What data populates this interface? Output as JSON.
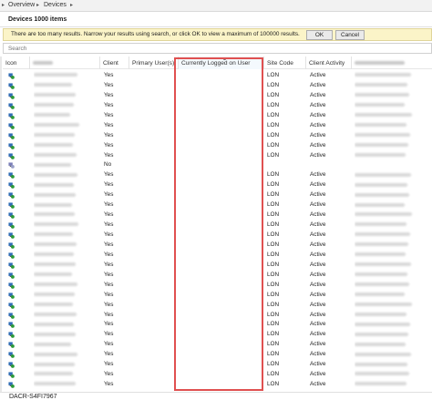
{
  "breadcrumb": {
    "items": [
      "Overview",
      "Devices"
    ]
  },
  "title": "Devices 1000 items",
  "info_bar": {
    "message": "There are too many results. Narrow your results using search, or click OK to view a maximum of 100000 results.",
    "ok_label": "OK",
    "cancel_label": "Cancel"
  },
  "search": {
    "placeholder": "Search"
  },
  "columns": {
    "icon": "Icon",
    "client": "Client",
    "primary_users": "Primary User(s)",
    "currently_logged_on_user": "Currently Logged on User",
    "site_code": "Site Code",
    "client_activity": "Client Activity"
  },
  "rows": [
    {
      "client": "Yes",
      "site": "LON",
      "activity": "Active",
      "icon": "device-client-icon"
    },
    {
      "client": "Yes",
      "site": "LON",
      "activity": "Active",
      "icon": "device-client-icon"
    },
    {
      "client": "Yes",
      "site": "LON",
      "activity": "Active",
      "icon": "device-client-icon"
    },
    {
      "client": "Yes",
      "site": "LON",
      "activity": "Active",
      "icon": "device-client-icon"
    },
    {
      "client": "Yes",
      "site": "LON",
      "activity": "Active",
      "icon": "device-client-icon"
    },
    {
      "client": "Yes",
      "site": "LON",
      "activity": "Active",
      "icon": "device-client-icon"
    },
    {
      "client": "Yes",
      "site": "LON",
      "activity": "Active",
      "icon": "device-client-icon"
    },
    {
      "client": "Yes",
      "site": "LON",
      "activity": "Active",
      "icon": "device-client-icon"
    },
    {
      "client": "Yes",
      "site": "LON",
      "activity": "Active",
      "icon": "device-client-icon"
    },
    {
      "client": "No",
      "site": "",
      "activity": "",
      "icon": "device-noclient-icon"
    },
    {
      "client": "Yes",
      "site": "LON",
      "activity": "Active",
      "icon": "device-client-icon"
    },
    {
      "client": "Yes",
      "site": "LON",
      "activity": "Active",
      "icon": "device-client-icon"
    },
    {
      "client": "Yes",
      "site": "LON",
      "activity": "Active",
      "icon": "device-client-icon"
    },
    {
      "client": "Yes",
      "site": "LON",
      "activity": "Active",
      "icon": "device-client-icon"
    },
    {
      "client": "Yes",
      "site": "LON",
      "activity": "Active",
      "icon": "device-client-icon"
    },
    {
      "client": "Yes",
      "site": "LON",
      "activity": "Active",
      "icon": "device-client-icon"
    },
    {
      "client": "Yes",
      "site": "LON",
      "activity": "Active",
      "icon": "device-client-icon"
    },
    {
      "client": "Yes",
      "site": "LON",
      "activity": "Active",
      "icon": "device-client-icon"
    },
    {
      "client": "Yes",
      "site": "LON",
      "activity": "Active",
      "icon": "device-client-icon"
    },
    {
      "client": "Yes",
      "site": "LON",
      "activity": "Active",
      "icon": "device-client-icon"
    },
    {
      "client": "Yes",
      "site": "LON",
      "activity": "Active",
      "icon": "device-client-icon"
    },
    {
      "client": "Yes",
      "site": "LON",
      "activity": "Active",
      "icon": "device-client-icon"
    },
    {
      "client": "Yes",
      "site": "LON",
      "activity": "Active",
      "icon": "device-client-icon"
    },
    {
      "client": "Yes",
      "site": "LON",
      "activity": "Active",
      "icon": "device-client-icon"
    },
    {
      "client": "Yes",
      "site": "LON",
      "activity": "Active",
      "icon": "device-client-icon"
    },
    {
      "client": "Yes",
      "site": "LON",
      "activity": "Active",
      "icon": "device-client-icon"
    },
    {
      "client": "Yes",
      "site": "LON",
      "activity": "Active",
      "icon": "device-client-icon"
    },
    {
      "client": "Yes",
      "site": "LON",
      "activity": "Active",
      "icon": "device-client-icon"
    },
    {
      "client": "Yes",
      "site": "LON",
      "activity": "Active",
      "icon": "device-client-icon"
    },
    {
      "client": "Yes",
      "site": "LON",
      "activity": "Active",
      "icon": "device-client-icon"
    },
    {
      "client": "Yes",
      "site": "LON",
      "activity": "Active",
      "icon": "device-client-icon"
    },
    {
      "client": "Yes",
      "site": "LON",
      "activity": "Active",
      "icon": "device-client-icon"
    }
  ],
  "status_bar": {
    "selected_device": "DACR-S4FI7967"
  },
  "colors": {
    "highlight_border": "#e05050",
    "info_bar_bg": "#fbf4c8",
    "icon_green": "#2e9a3a",
    "icon_blue": "#2f6db5"
  }
}
